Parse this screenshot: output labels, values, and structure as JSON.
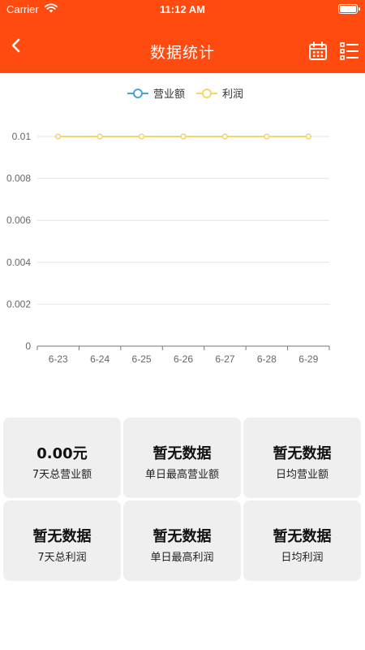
{
  "status_bar": {
    "carrier": "Carrier",
    "time": "11:12 AM"
  },
  "nav": {
    "title": "数据统计",
    "back_icon": "chevron-left-icon",
    "calendar_icon": "calendar-icon",
    "list_icon": "list-icon"
  },
  "colors": {
    "primary": "#ff4a10",
    "revenue_series": "#4aa3d3",
    "profit_series": "#f6d56a",
    "card_bg": "#efefef"
  },
  "legend": [
    {
      "label": "营业额",
      "color": "#4aa3d3"
    },
    {
      "label": "利润",
      "color": "#f6d56a"
    }
  ],
  "chart_data": {
    "type": "line",
    "categories": [
      "6-23",
      "6-24",
      "6-25",
      "6-26",
      "6-27",
      "6-28",
      "6-29"
    ],
    "series": [
      {
        "name": "营业额",
        "color": "#4aa3d3",
        "values": [
          0.01,
          0.01,
          0.01,
          0.01,
          0.01,
          0.01,
          0.01
        ]
      },
      {
        "name": "利润",
        "color": "#f6d56a",
        "values": [
          0.01,
          0.01,
          0.01,
          0.01,
          0.01,
          0.01,
          0.01
        ]
      }
    ],
    "yticks": [
      "0",
      "0.002",
      "0.004",
      "0.006",
      "0.008",
      "0.01"
    ],
    "ylim": [
      0,
      0.01
    ],
    "grid": true,
    "legend_position": "top-center"
  },
  "stats": [
    {
      "value": "0.00元",
      "label": "7天总营业额"
    },
    {
      "value": "暂无数据",
      "label": "单日最高营业额"
    },
    {
      "value": "暂无数据",
      "label": "日均营业额"
    },
    {
      "value": "暂无数据",
      "label": "7天总利润"
    },
    {
      "value": "暂无数据",
      "label": "单日最高利润"
    },
    {
      "value": "暂无数据",
      "label": "日均利润"
    }
  ]
}
